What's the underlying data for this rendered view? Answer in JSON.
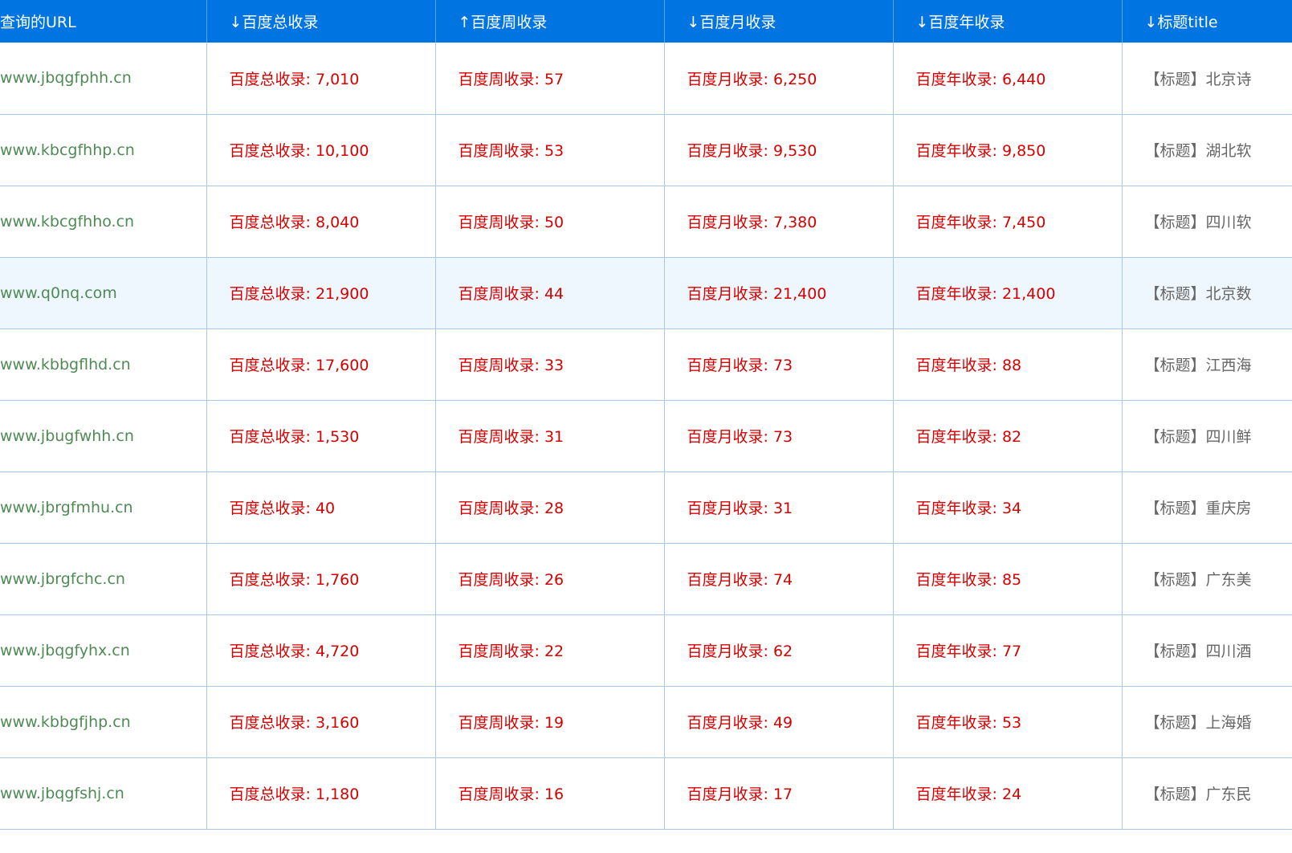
{
  "table": {
    "headers": {
      "url": "查询的URL",
      "total": "↓百度总收录",
      "week": "↑百度周收录",
      "month": "↓百度月收录",
      "year": "↓百度年收录",
      "title": "↓标题title"
    },
    "rows": [
      {
        "url": "www.jbqgfphh.cn",
        "total": "百度总收录: 7,010",
        "week": "百度周收录: 57",
        "month": "百度月收录: 6,250",
        "year": "百度年收录: 6,440",
        "title": "【标题】北京诗"
      },
      {
        "url": "www.kbcgfhhp.cn",
        "total": "百度总收录: 10,100",
        "week": "百度周收录: 53",
        "month": "百度月收录: 9,530",
        "year": "百度年收录: 9,850",
        "title": "【标题】湖北软"
      },
      {
        "url": "www.kbcgfhho.cn",
        "total": "百度总收录: 8,040",
        "week": "百度周收录: 50",
        "month": "百度月收录: 7,380",
        "year": "百度年收录: 7,450",
        "title": "【标题】四川软"
      },
      {
        "url": "www.q0nq.com",
        "total": "百度总收录: 21,900",
        "week": "百度周收录: 44",
        "month": "百度月收录: 21,400",
        "year": "百度年收录: 21,400",
        "title": "【标题】北京数"
      },
      {
        "url": "www.kbbgflhd.cn",
        "total": "百度总收录: 17,600",
        "week": "百度周收录: 33",
        "month": "百度月收录: 73",
        "year": "百度年收录: 88",
        "title": "【标题】江西海"
      },
      {
        "url": "www.jbugfwhh.cn",
        "total": "百度总收录: 1,530",
        "week": "百度周收录: 31",
        "month": "百度月收录: 73",
        "year": "百度年收录: 82",
        "title": "【标题】四川鲜"
      },
      {
        "url": "www.jbrgfmhu.cn",
        "total": "百度总收录: 40",
        "week": "百度周收录: 28",
        "month": "百度月收录: 31",
        "year": "百度年收录: 34",
        "title": "【标题】重庆房"
      },
      {
        "url": "www.jbrgfchc.cn",
        "total": "百度总收录: 1,760",
        "week": "百度周收录: 26",
        "month": "百度月收录: 74",
        "year": "百度年收录: 85",
        "title": "【标题】广东美"
      },
      {
        "url": "www.jbqgfyhx.cn",
        "total": "百度总收录: 4,720",
        "week": "百度周收录: 22",
        "month": "百度月收录: 62",
        "year": "百度年收录: 77",
        "title": "【标题】四川酒"
      },
      {
        "url": "www.kbbgfjhp.cn",
        "total": "百度总收录: 3,160",
        "week": "百度周收录: 19",
        "month": "百度月收录: 49",
        "year": "百度年收录: 53",
        "title": "【标题】上海婚"
      },
      {
        "url": "www.jbqgfshj.cn",
        "total": "百度总收录: 1,180",
        "week": "百度周收录: 16",
        "month": "百度月收录: 17",
        "year": "百度年收录: 24",
        "title": "【标题】广东民"
      }
    ]
  }
}
